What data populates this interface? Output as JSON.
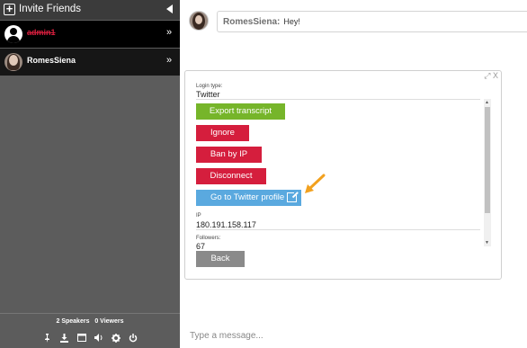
{
  "sidebar": {
    "invite_label": "Invite Friends",
    "users": [
      {
        "name": "admin1",
        "name_color": "#d51e3d",
        "action": "»"
      },
      {
        "name": "RomesSiena",
        "name_color": "#ffffff",
        "action": "»"
      }
    ],
    "counts": {
      "speakers_count": "2",
      "speakers_label": "Speakers",
      "viewers_count": "0",
      "viewers_label": "Viewers"
    },
    "toolbar_icons": [
      "pin-icon",
      "download-icon",
      "window-icon",
      "volume-icon",
      "gear-icon",
      "power-icon"
    ]
  },
  "chat": {
    "messages": [
      {
        "sender": "RomesSiena:",
        "text": "Hey!"
      }
    ],
    "input_placeholder": "Type a message..."
  },
  "user_panel": {
    "window_controls": "⤢ X",
    "login_type_label": "Login type:",
    "login_type_value": "Twitter",
    "buttons": {
      "export": "Export transcript",
      "ignore": "Ignore",
      "ban": "Ban by IP",
      "disconnect": "Disconnect",
      "twitter": "Go to Twitter profile",
      "back": "Back"
    },
    "ip_label": "IP",
    "ip_value": "180.191.158.117",
    "followers_label": "Followers:",
    "followers_value": "67"
  },
  "colors": {
    "green": "#76b52a",
    "red": "#d51e3d",
    "blue": "#5aa9df",
    "grey": "#8a8a8a",
    "arrow": "#f2a11f"
  }
}
